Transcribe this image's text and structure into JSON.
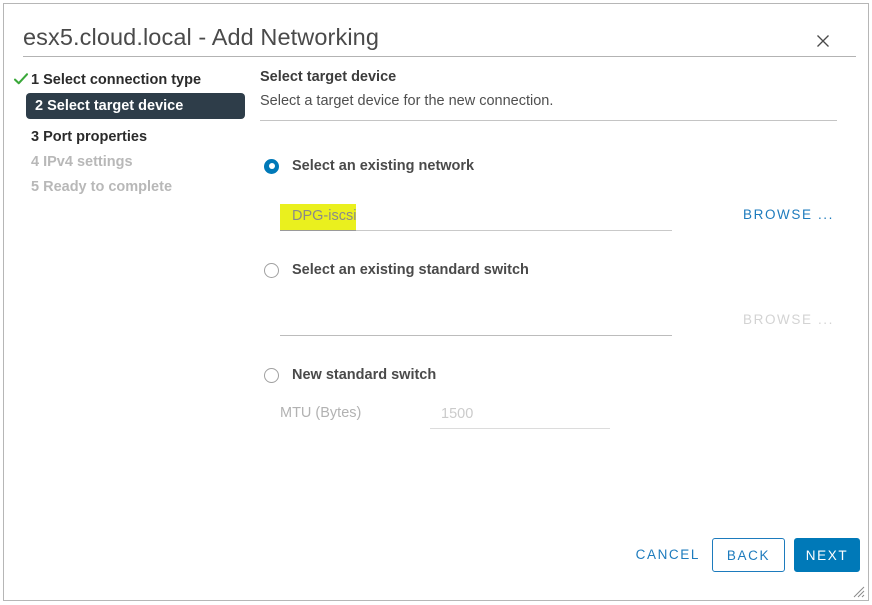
{
  "window": {
    "title": "esx5.cloud.local - Add Networking",
    "close_icon": "close-icon",
    "resize_grip_icon": "resize-grip-icon"
  },
  "wizard": {
    "steps": [
      {
        "number": "1",
        "label": "1 Select connection type",
        "state": "completed",
        "icon": "check-icon"
      },
      {
        "number": "2",
        "label": "2 Select target device",
        "state": "active"
      },
      {
        "number": "3",
        "label": "3 Port properties",
        "state": "upcoming"
      },
      {
        "number": "4",
        "label": "4 IPv4 settings",
        "state": "disabled"
      },
      {
        "number": "5",
        "label": "5 Ready to complete",
        "state": "disabled"
      }
    ]
  },
  "content": {
    "title": "Select target device",
    "subtitle": "Select a target device for the new connection.",
    "options": [
      {
        "id": "existing-network",
        "label": "Select an existing network",
        "selected": true,
        "field_value": "DPG-iscsi",
        "field_highlighted": true,
        "browse_label": "BROWSE ...",
        "browse_enabled": true
      },
      {
        "id": "existing-standard-switch",
        "label": "Select an existing standard switch",
        "selected": false,
        "field_value": "",
        "field_highlighted": false,
        "browse_label": "BROWSE ...",
        "browse_enabled": false
      },
      {
        "id": "new-standard-switch",
        "label": "New standard switch",
        "selected": false,
        "mtu_label": "MTU (Bytes)",
        "mtu_value": "1500"
      }
    ]
  },
  "footer": {
    "cancel_label": "CANCEL",
    "back_label": "BACK",
    "next_label": "NEXT"
  },
  "colors": {
    "accent_blue": "#0079b8",
    "link_blue": "#1d7bbd",
    "active_step_bg": "#2e3d49",
    "check_green": "#3aa83a",
    "highlight_yellow": "#eaf01e",
    "disabled_gray": "#b8b8b8"
  }
}
